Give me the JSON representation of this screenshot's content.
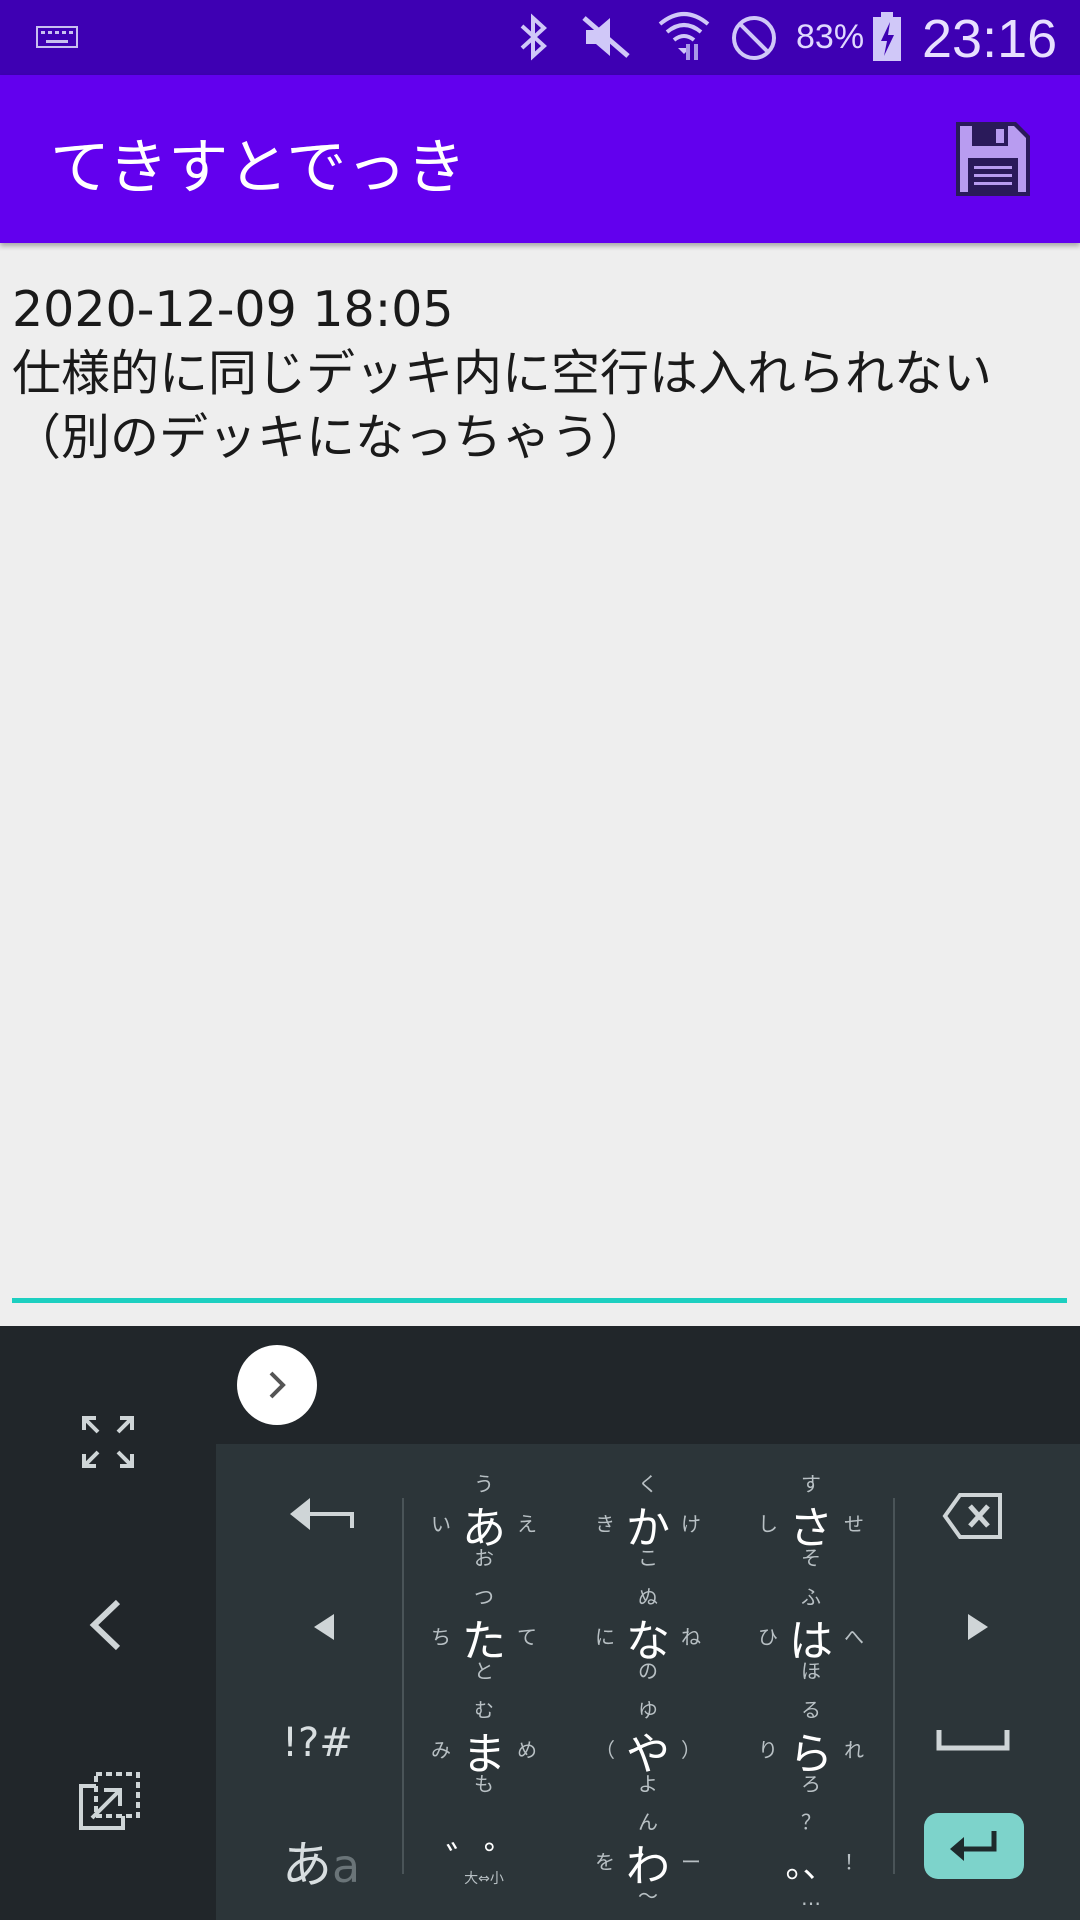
{
  "status_bar": {
    "keyboard_icon": "keyboard-icon",
    "battery_percent": "83%",
    "time": "23:16"
  },
  "app_bar": {
    "title": "てきすとでっき",
    "save_icon": "floppy-disk-icon"
  },
  "editor": {
    "text": "2020-12-09 18:05\n仕様的に同じデッキ内に空行は入れられない\n（別のデッキになっちゃう）"
  },
  "keyboard": {
    "colors": {
      "background": "#21262a",
      "keys": "#2c3539",
      "enter": "#7dd3cb",
      "underline": "#1ccfc0"
    },
    "kana_keys": [
      {
        "main": "あ",
        "top": "う",
        "left": "い",
        "right": "え",
        "bottom": "お"
      },
      {
        "main": "か",
        "top": "く",
        "left": "き",
        "right": "け",
        "bottom": "こ"
      },
      {
        "main": "さ",
        "top": "す",
        "left": "し",
        "right": "せ",
        "bottom": "そ"
      },
      {
        "main": "た",
        "top": "つ",
        "left": "ち",
        "right": "て",
        "bottom": "と"
      },
      {
        "main": "な",
        "top": "ぬ",
        "left": "に",
        "right": "ね",
        "bottom": "の"
      },
      {
        "main": "は",
        "top": "ふ",
        "left": "ひ",
        "right": "へ",
        "bottom": "ほ"
      },
      {
        "main": "ま",
        "top": "む",
        "left": "み",
        "right": "め",
        "bottom": "も"
      },
      {
        "main": "や",
        "top": "ゆ",
        "left": "（",
        "right": "）",
        "bottom": "よ"
      },
      {
        "main": "ら",
        "top": "る",
        "left": "り",
        "right": "れ",
        "bottom": "ろ"
      },
      {
        "main": "゛゜",
        "top": "",
        "left": "",
        "right": "",
        "bottom": "大⇔小"
      },
      {
        "main": "わ",
        "top": "ん",
        "left": "を",
        "right": "ー",
        "bottom": "〜"
      },
      {
        "main": "。、",
        "top": "？",
        "left": "",
        "right": "！",
        "bottom": "…"
      }
    ],
    "symbols_label": "!?#",
    "mode_label_main": "あ",
    "mode_label_sub": "a"
  }
}
